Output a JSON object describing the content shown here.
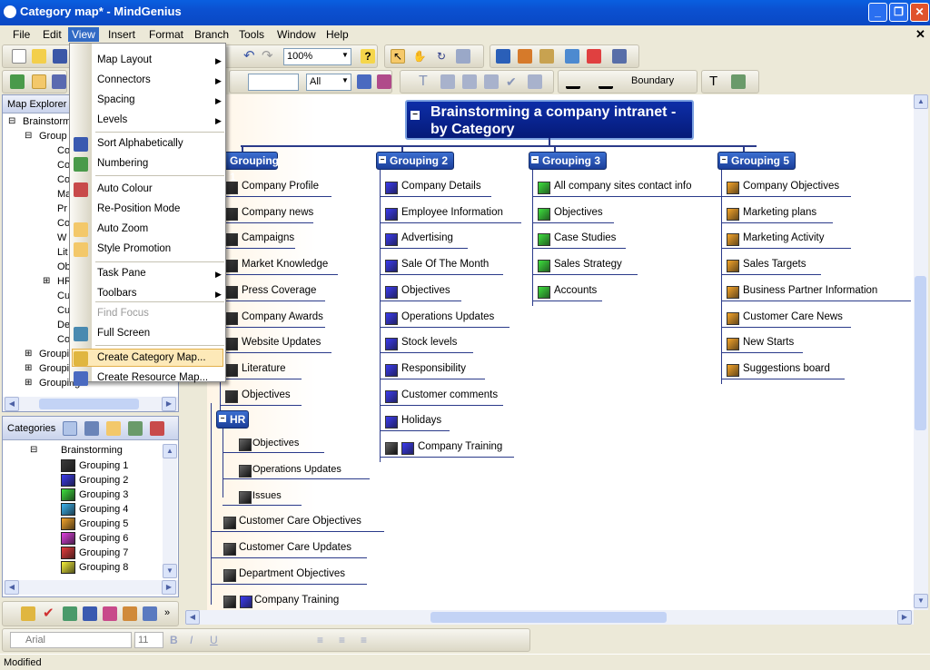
{
  "window": {
    "title": "Category map* - MindGenius"
  },
  "menubar": [
    "File",
    "Edit",
    "View",
    "Insert",
    "Format",
    "Branch",
    "Tools",
    "Window",
    "Help"
  ],
  "toolbar": {
    "zoom": "100%",
    "level": "All",
    "boundary": "Boundary"
  },
  "view_menu": {
    "items": [
      {
        "label": "Map Layout",
        "submenu": true
      },
      {
        "label": "Connectors",
        "submenu": true
      },
      {
        "label": "Spacing",
        "submenu": true
      },
      {
        "label": "Levels",
        "submenu": true
      },
      {
        "label": "Sort Alphabetically"
      },
      {
        "label": "Numbering"
      },
      {
        "label": "Auto Colour"
      },
      {
        "label": "Re-Position Mode"
      },
      {
        "label": "Auto Zoom"
      },
      {
        "label": "Style Promotion"
      },
      {
        "label": "Task Pane",
        "submenu": true
      },
      {
        "label": "Toolbars",
        "submenu": true
      },
      {
        "label": "Find Focus",
        "disabled": true
      },
      {
        "label": "Full Screen"
      },
      {
        "label": "Create Category Map..."
      },
      {
        "label": "Create Resource Map..."
      }
    ]
  },
  "map_explorer": {
    "title": "Map Explorer",
    "tree": [
      "Brainstorm",
      "Group",
      "Co",
      "Co",
      "Co",
      "Ma",
      "Pr",
      "Co",
      "W",
      "Lit",
      "Ob",
      "HR",
      "Cu",
      "Cu",
      "De",
      "Co",
      "Grouping",
      "Grouping",
      "Grouping 3"
    ]
  },
  "categories": {
    "title": "Categories",
    "root": "Brainstorming",
    "items": [
      {
        "label": "Grouping 1",
        "color": "#3a3a3a"
      },
      {
        "label": "Grouping 2",
        "color": "#3c3cf0"
      },
      {
        "label": "Grouping 3",
        "color": "#3ee03e"
      },
      {
        "label": "Grouping 4",
        "color": "#3cb4f0"
      },
      {
        "label": "Grouping 5",
        "color": "#f5a52a"
      },
      {
        "label": "Grouping 6",
        "color": "#e040e0"
      },
      {
        "label": "Grouping 7",
        "color": "#e83c3c"
      },
      {
        "label": "Grouping 8",
        "color": "#f5f03a"
      }
    ]
  },
  "map": {
    "central": "Brainstorming a company intranet - by Category",
    "groups": [
      {
        "title": "Grouping 1",
        "color": "#3a3a3a",
        "items": [
          "Company Profile",
          "Company news",
          "Campaigns",
          "Market Knowledge",
          "Press Coverage",
          "Company Awards",
          "Website Updates",
          "Literature",
          "Objectives"
        ]
      },
      {
        "title": "Grouping 2",
        "color": "#3c3cf0",
        "items": [
          "Company Details",
          "Employee Information",
          "Advertising",
          "Sale Of The Month",
          "Objectives",
          "Operations Updates",
          "Stock levels",
          "Responsibility",
          "Customer comments",
          "Holidays",
          "Company Training"
        ]
      },
      {
        "title": "Grouping 3",
        "color": "#3ee03e",
        "items": [
          "All company sites contact info",
          "Objectives",
          "Case Studies",
          "Sales Strategy",
          "Accounts"
        ]
      },
      {
        "title": "Grouping 5",
        "color": "#f5a52a",
        "items": [
          "Company Objectives",
          "Marketing plans",
          "Marketing Activity",
          "Sales Targets",
          "Business Partner Information",
          "Customer Care News",
          "New Starts",
          "Suggestions board"
        ]
      }
    ],
    "hr": {
      "title": "HR",
      "items": [
        "Objectives",
        "Operations Updates",
        "Issues"
      ]
    },
    "g1_extra": [
      "Customer Care Objectives",
      "Customer Care Updates",
      "Department Objectives",
      "Company Training"
    ]
  },
  "format_bar": {
    "font": "Arial",
    "size": "11"
  },
  "status": "Modified"
}
